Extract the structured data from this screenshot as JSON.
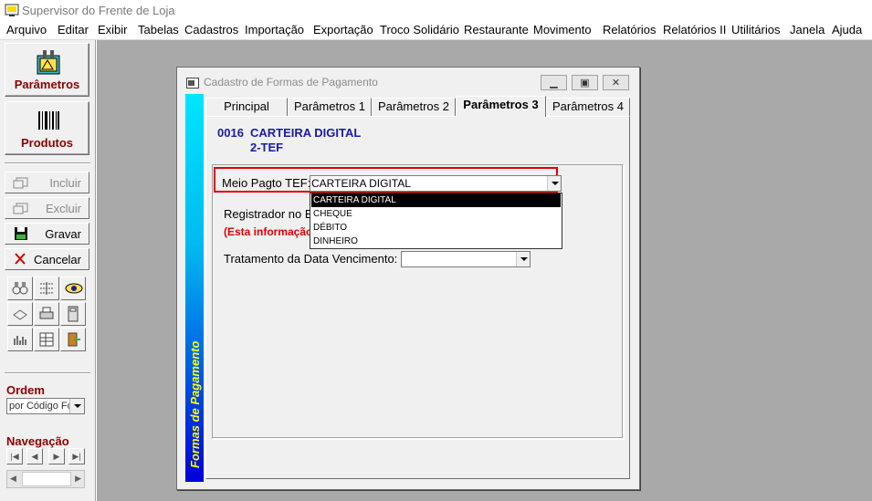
{
  "app": {
    "title": "Supervisor do Frente de Loja"
  },
  "menu": [
    "Arquivo",
    "Editar",
    "Exibir",
    "Tabelas",
    "Cadastros",
    "Importação",
    "Exportação",
    "Troco Solidário",
    "Restaurante",
    "Movimento",
    "Relatórios",
    "Relatórios II",
    "Utilitários",
    "Janela",
    "Ajuda"
  ],
  "toolbar": {
    "parametros_label": "Parâmetros",
    "produtos_label": "Produtos",
    "incluir_label": "Incluir",
    "excluir_label": "Excluir",
    "gravar_label": "Gravar",
    "cancelar_label": "Cancelar",
    "ordem_title": "Ordem",
    "ordem_value": "por Código Fo",
    "navegacao_title": "Navegação"
  },
  "window": {
    "title": "Cadastro de Formas de Pagamento",
    "side_banner": "Formas de Pagamento",
    "tabs": [
      "Principal",
      "Parâmetros 1",
      "Parâmetros 2",
      "Parâmetros 3",
      "Parâmetros 4"
    ],
    "active_tab": "Parâmetros 3"
  },
  "record": {
    "code": "0016",
    "name": "CARTEIRA DIGITAL",
    "sub": "2-TEF"
  },
  "form": {
    "meio_pagto_label": "Meio Pagto TEF:",
    "meio_pagto_value": "CARTEIRA DIGITAL",
    "dropdown_options": [
      "CARTEIRA DIGITAL",
      "CHEQUE",
      "DÉBITO",
      "DINHEIRO"
    ],
    "dropdown_selected": "CARTEIRA DIGITAL",
    "registrador_label": "Registrador no E",
    "info_label": "(Esta informação",
    "vencimento_label": "Tratamento da Data Vencimento:",
    "vencimento_value": ""
  },
  "colors": {
    "accent_red": "#8b0000",
    "record_blue": "#1a1aa8",
    "workspace": "#a9a9a9",
    "highlight_box": "#e00000"
  }
}
